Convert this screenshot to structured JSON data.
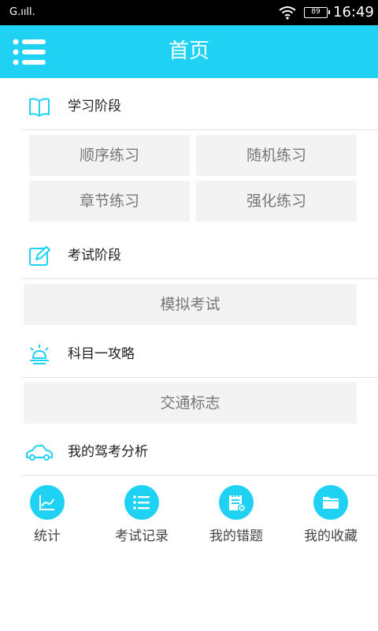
{
  "statusbar": {
    "carrier": "G.ııll.",
    "battery": "89",
    "time": "16:49"
  },
  "appbar": {
    "title": "首页",
    "menu_icon": "menu-list-icon"
  },
  "colors": {
    "accent": "#1fd2f4",
    "button_bg": "#f3f3f3",
    "button_text": "#777777"
  },
  "sections": {
    "study": {
      "title": "学习阶段",
      "icon": "book-icon",
      "buttons": [
        "顺序练习",
        "随机练习",
        "章节练习",
        "强化练习"
      ]
    },
    "exam": {
      "title": "考试阶段",
      "icon": "edit-icon",
      "buttons": [
        "模拟考试"
      ]
    },
    "strategy": {
      "title": "科目一攻略",
      "icon": "lamp-icon",
      "buttons": [
        "交通标志"
      ]
    },
    "analysis": {
      "title": "我的驾考分析",
      "icon": "car-icon"
    }
  },
  "bottom_nav": [
    {
      "label": "统计",
      "icon": "chart-icon"
    },
    {
      "label": "考试记录",
      "icon": "list-icon"
    },
    {
      "label": "我的错题",
      "icon": "wrong-note-icon"
    },
    {
      "label": "我的收藏",
      "icon": "folder-icon"
    }
  ]
}
